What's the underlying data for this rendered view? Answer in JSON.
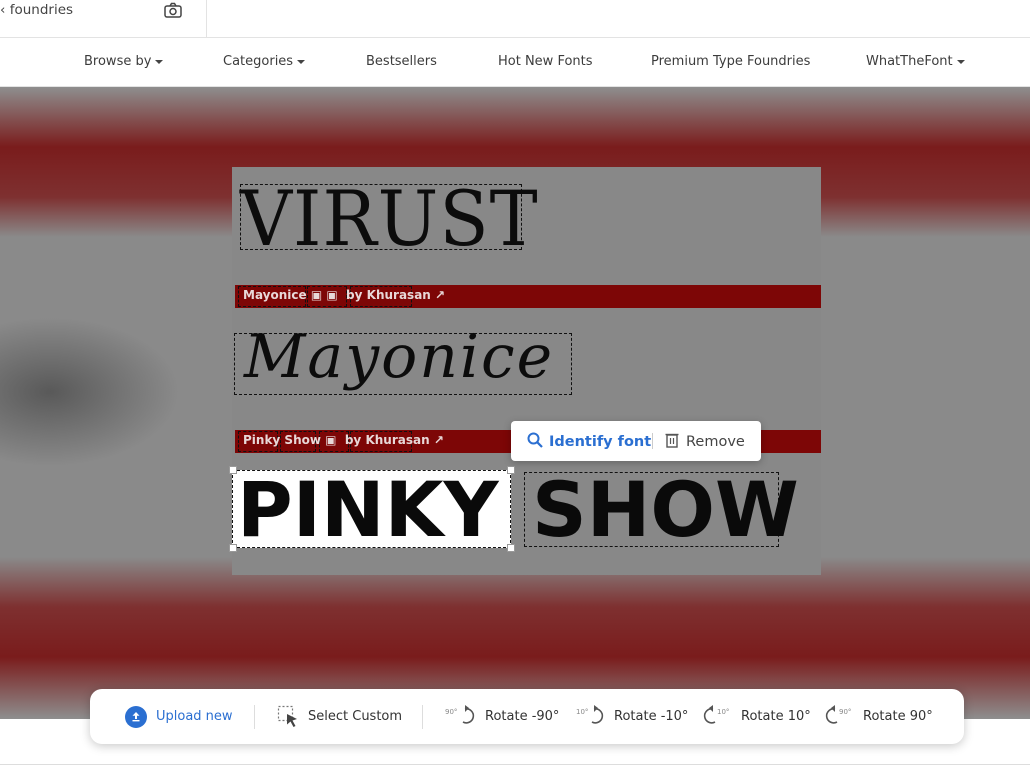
{
  "search": {
    "text": "foundries"
  },
  "nav": {
    "items": [
      {
        "label": "Browse by",
        "dropdown": true
      },
      {
        "label": "Categories",
        "dropdown": true
      },
      {
        "label": "Bestsellers",
        "dropdown": false
      },
      {
        "label": "Hot New Fonts",
        "dropdown": false
      },
      {
        "label": "Premium Type Foundries",
        "dropdown": false
      },
      {
        "label": "WhatTheFont",
        "dropdown": true
      }
    ]
  },
  "canvas": {
    "sample1": "VIRUST",
    "bar1": {
      "font": "Mayonice",
      "by": "by",
      "foundry": "Khurasan"
    },
    "sample2": "Mayonice",
    "bar2": {
      "font": "Pinky Show",
      "by": "by",
      "foundry": "Khurasan"
    },
    "sample3a": "PINKY",
    "sample3b": "SHOW"
  },
  "popup": {
    "identify": "Identify font",
    "remove": "Remove"
  },
  "toolbar": {
    "upload": "Upload new",
    "select_custom": "Select Custom",
    "rotate_m90": "Rotate -90°",
    "rotate_m10": "Rotate -10°",
    "rotate_p10": "Rotate 10°",
    "rotate_p90": "Rotate 90°",
    "icon_m90": "90°",
    "icon_m10": "10°",
    "icon_p10": "10°",
    "icon_p90": "90°"
  },
  "colors": {
    "accent": "#2b6fd1",
    "bar": "#7d0606"
  }
}
